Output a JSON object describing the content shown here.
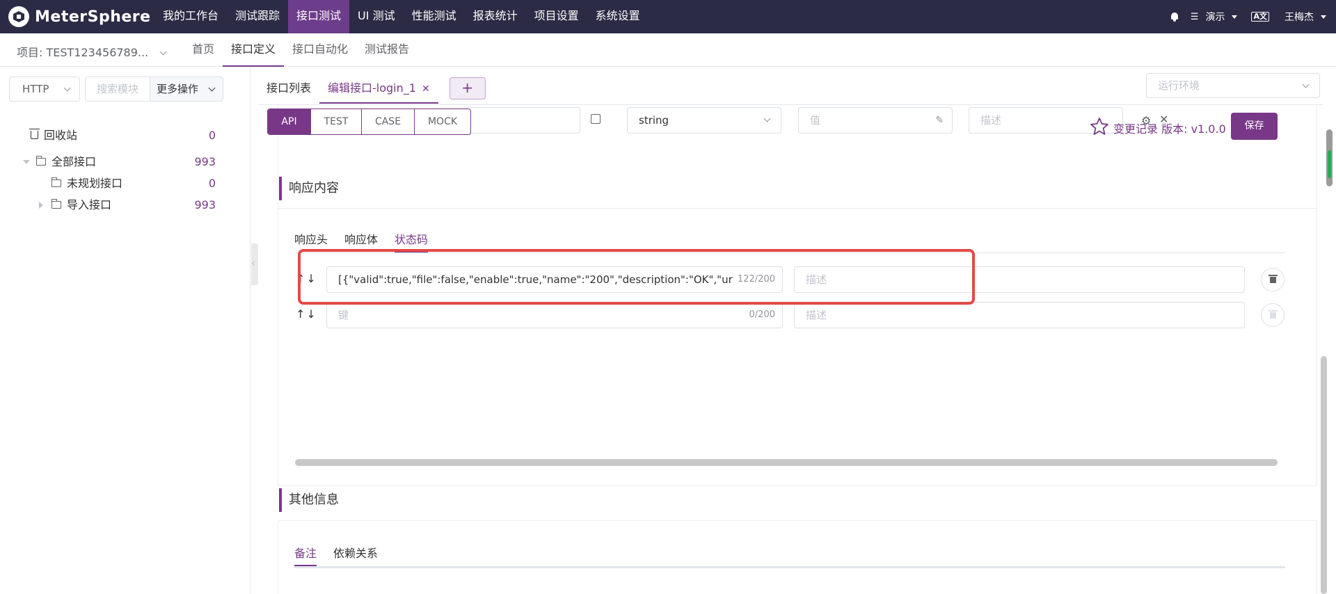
{
  "app": {
    "name": "MeterSphere"
  },
  "topnav": {
    "items": [
      "我的工作台",
      "测试跟踪",
      "接口测试",
      "UI 测试",
      "性能测试",
      "报表统计",
      "项目设置",
      "系统设置"
    ],
    "active_index": 2,
    "workspace": "演示",
    "user": "王梅杰"
  },
  "subnav": {
    "project": "项目: TEST123456789...",
    "tabs": [
      "首页",
      "接口定义",
      "接口自动化",
      "测试报告"
    ],
    "active_index": 1
  },
  "sidebar": {
    "protocol": "HTTP",
    "search_placeholder": "搜索模块",
    "more_ops": "更多操作",
    "tree": [
      {
        "label": "回收站",
        "count": "0"
      },
      {
        "label": "全部接口",
        "count": "993"
      },
      {
        "label": "未规划接口",
        "count": "0"
      },
      {
        "label": "导入接口",
        "count": "993"
      }
    ]
  },
  "main": {
    "tabs": {
      "list": "接口列表",
      "edit": "编辑接口-login_1",
      "close": "✕",
      "add": "+"
    },
    "env_placeholder": "运行环境",
    "mode_buttons": [
      "API",
      "TEST",
      "CASE",
      "MOCK"
    ],
    "favorite_icon": "star-icon",
    "version_text": "变更记录 版本: v1.0.0",
    "save_label": "保存",
    "param_row": {
      "type": "string",
      "value_placeholder": "值",
      "desc_placeholder": "描述"
    },
    "response": {
      "title": "响应内容",
      "tabs": [
        "响应头",
        "响应体",
        "状态码"
      ],
      "active_index": 2,
      "rows": [
        {
          "arrows": "↑↓",
          "key": "[{\"valid\":true,\"file\":false,\"enable\":true,\"name\":\"200\",\"description\":\"OK\",\"urlEncode",
          "key_count": "122/200",
          "desc_placeholder": "描述"
        },
        {
          "arrows": "↑↓",
          "key_placeholder": "键",
          "key_count": "0/200",
          "desc_placeholder": "描述"
        }
      ]
    },
    "other": {
      "title": "其他信息",
      "tabs": [
        "备注",
        "依赖关系"
      ],
      "active_index": 0
    }
  },
  "colors": {
    "brand": "#783887",
    "topbar": "#2c2b46",
    "highlight": "#e34a47"
  }
}
